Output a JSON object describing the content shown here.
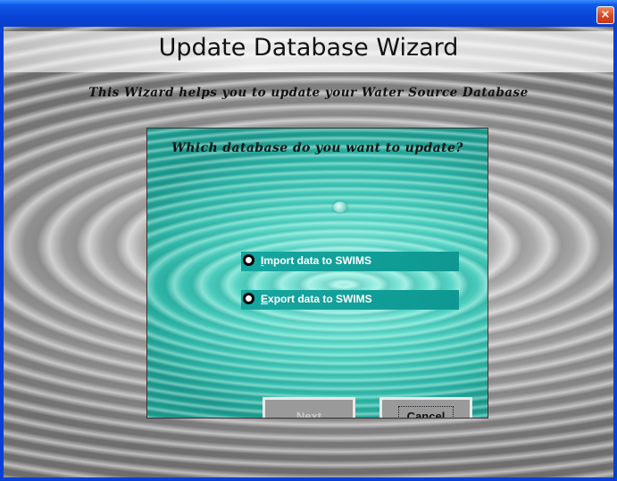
{
  "window": {
    "close_glyph": "×"
  },
  "header": {
    "title": "Update Database Wizard",
    "subtitle": "This Wizard helps you to update your Water Source Database"
  },
  "panel": {
    "question": "Which database do you want to update?",
    "options": [
      {
        "accel": "I",
        "rest": "mport data to SWIMS",
        "selected": false
      },
      {
        "accel": "E",
        "rest": "xport data to SWIMS",
        "selected": false
      }
    ]
  },
  "buttons": {
    "next": {
      "accel": "N",
      "rest": "ext",
      "enabled": false
    },
    "cancel": {
      "accel": "C",
      "rest": "ancel",
      "enabled": true
    }
  },
  "colors": {
    "titlebar": "#0a46d9",
    "panel_teal": "#2fb7a8",
    "option_bg": "#15a7a0"
  }
}
